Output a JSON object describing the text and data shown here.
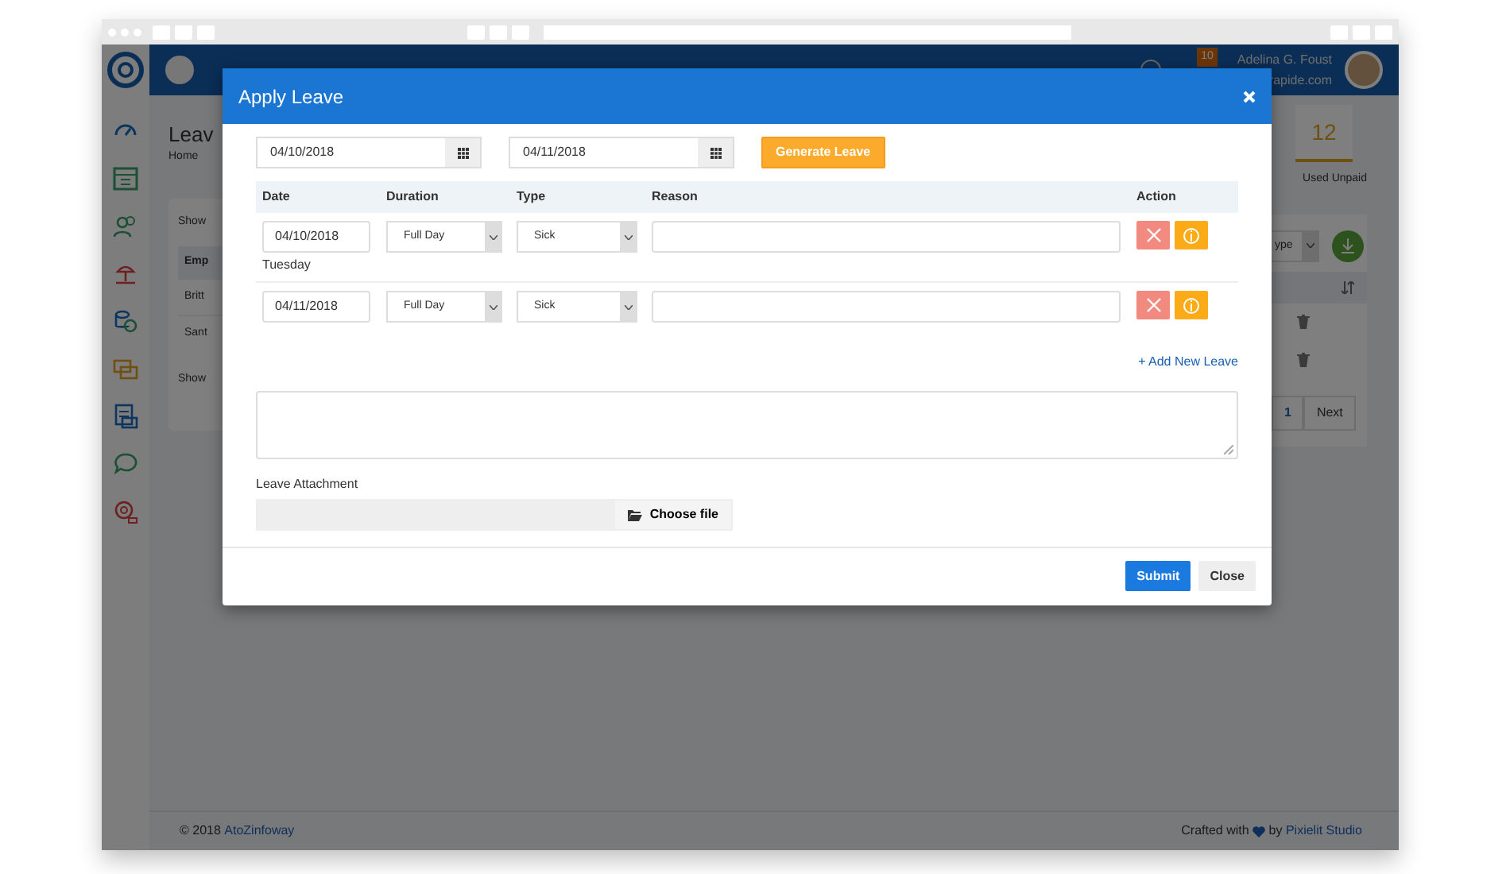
{
  "header": {
    "notification_count": "10",
    "user_name": "Adelina G. Foust",
    "user_email": "rapide.com"
  },
  "page": {
    "title": "Leav",
    "breadcrumb": "Home"
  },
  "stats_card": {
    "value": "12",
    "label": "Used Unpaid"
  },
  "table_card": {
    "show_top": "Show",
    "column": "Emp",
    "rows": [
      "Britt",
      "Sant"
    ],
    "show_bottom": "Show",
    "filter_select": "ype",
    "pagination": [
      {
        "label": "1",
        "selected": true
      },
      {
        "label": "Next",
        "selected": false
      }
    ]
  },
  "modal": {
    "title": "Apply Leave",
    "from_date": "04/10/2018",
    "to_date": "04/11/2018",
    "generate_button": "Generate Leave",
    "columns": [
      "Date",
      "Duration",
      "Type",
      "Reason",
      "Action"
    ],
    "leaves": [
      {
        "date": "04/10/2018",
        "weekday": "Tuesday",
        "duration": "Full Day",
        "type": "Sick"
      },
      {
        "date": "04/11/2018",
        "duration": "Full Day",
        "type": "Sick"
      }
    ],
    "add_link": "+ Add New Leave",
    "attachment_label": "Leave Attachment",
    "choose_file": "Choose file",
    "buttons": [
      {
        "label": "Submit",
        "kind": "primary"
      },
      {
        "label": "Close",
        "kind": "secondary"
      }
    ]
  },
  "footer": {
    "copyright": "© 2018",
    "company": "AtoZinfoway",
    "crafted_prefix": "Crafted with",
    "crafted_by": "by",
    "studio": "Pixielit Studio"
  }
}
